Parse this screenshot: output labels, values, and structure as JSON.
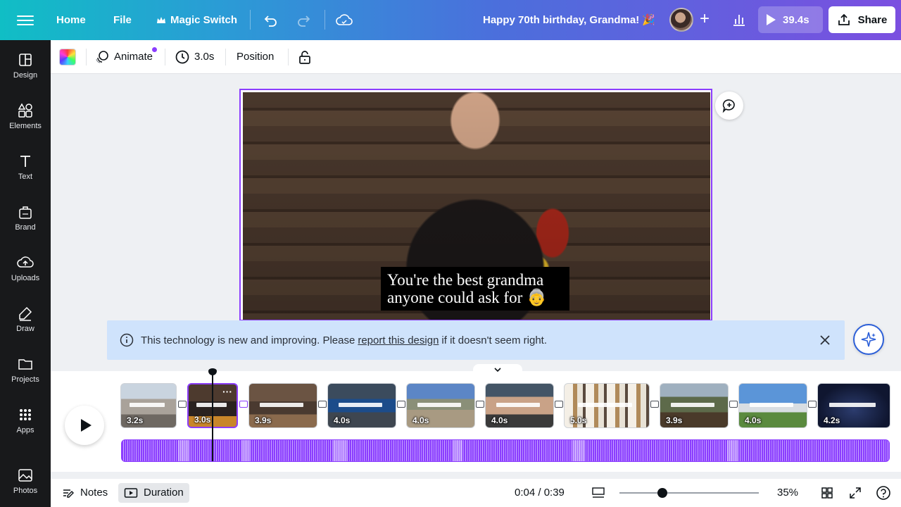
{
  "topbar": {
    "home": "Home",
    "file": "File",
    "magic_switch": "Magic Switch",
    "doc_title": "Happy 70th birthday, Grandma! 🎉",
    "play_duration": "39.4s",
    "share": "Share"
  },
  "sidebar": {
    "items": [
      {
        "label": "Design"
      },
      {
        "label": "Elements"
      },
      {
        "label": "Text"
      },
      {
        "label": "Brand"
      },
      {
        "label": "Uploads"
      },
      {
        "label": "Draw"
      },
      {
        "label": "Projects"
      },
      {
        "label": "Apps"
      },
      {
        "label": "Photos"
      }
    ]
  },
  "toolbar": {
    "animate": "Animate",
    "duration": "3.0s",
    "position": "Position"
  },
  "canvas": {
    "caption_line1": "You're the best grandma",
    "caption_line2": "anyone could ask for 👵"
  },
  "banner": {
    "text_before": "This technology is new and improving. Please",
    "link": "report this design",
    "text_after": "if it doesn't seem right."
  },
  "timeline": {
    "clips": [
      {
        "duration": "3.2s"
      },
      {
        "duration": "3.0s"
      },
      {
        "duration": "3.9s"
      },
      {
        "duration": "4.0s"
      },
      {
        "duration": "4.0s"
      },
      {
        "duration": "4.0s"
      },
      {
        "duration": "5.0s"
      },
      {
        "duration": "3.9s"
      },
      {
        "duration": "4.0s"
      },
      {
        "duration": "4.2s"
      }
    ]
  },
  "bottombar": {
    "notes": "Notes",
    "duration": "Duration",
    "time": "0:04 / 0:39",
    "zoom": "35%"
  },
  "colors": {
    "accent": "#8b3dff",
    "sidebar_bg": "#18191b",
    "banner_bg": "#cfe3fc"
  }
}
